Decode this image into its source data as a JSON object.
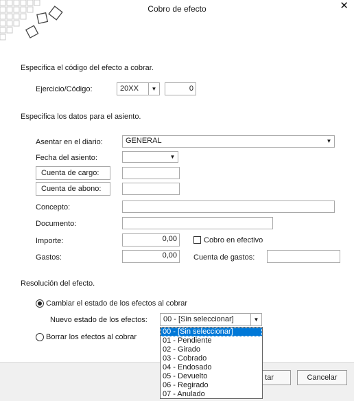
{
  "window": {
    "title": "Cobro de efecto",
    "close_symbol": "✕"
  },
  "section1": {
    "heading": "Especifica el código del efecto a cobrar.",
    "ejercicio_label": "Ejercicio/Código:",
    "ejercicio_value": "20XX",
    "codigo_value": "0"
  },
  "section2": {
    "heading": "Especifica los datos para el asiento.",
    "diario_label": "Asentar en el diario:",
    "diario_value": "GENERAL",
    "fecha_label": "Fecha del asiento:",
    "fecha_value": "",
    "cargo_label": "Cuenta de cargo:",
    "abono_label": "Cuenta de abono:",
    "concepto_label": "Concepto:",
    "documento_label": "Documento:",
    "importe_label": "Importe:",
    "importe_value": "0,00",
    "cobro_efectivo_label": "Cobro en efectivo",
    "cobro_efectivo_checked": false,
    "gastos_label": "Gastos:",
    "gastos_value": "0,00",
    "cuenta_gastos_label": "Cuenta de gastos:"
  },
  "section3": {
    "heading": "Resolución del efecto.",
    "radio_cambiar_label": "Cambiar el estado de los efectos al cobrar",
    "nuevo_estado_label": "Nuevo estado de los efectos:",
    "nuevo_estado_value": "00 - [Sin seleccionar]",
    "radio_borrar_label": "Borrar los efectos al cobrar",
    "estado_options": [
      "00 - [Sin seleccionar]",
      "01 - Pendiente",
      "02 - Girado",
      "03 - Cobrado",
      "04 - Endosado",
      "05 - Devuelto",
      "06 - Regirado",
      "07 - Anulado"
    ]
  },
  "footer": {
    "accept_label_partial": "tar",
    "cancel_label": "Cancelar"
  },
  "colors": {
    "selection": "#0078d7",
    "footer_bg": "#f0f0f0"
  }
}
